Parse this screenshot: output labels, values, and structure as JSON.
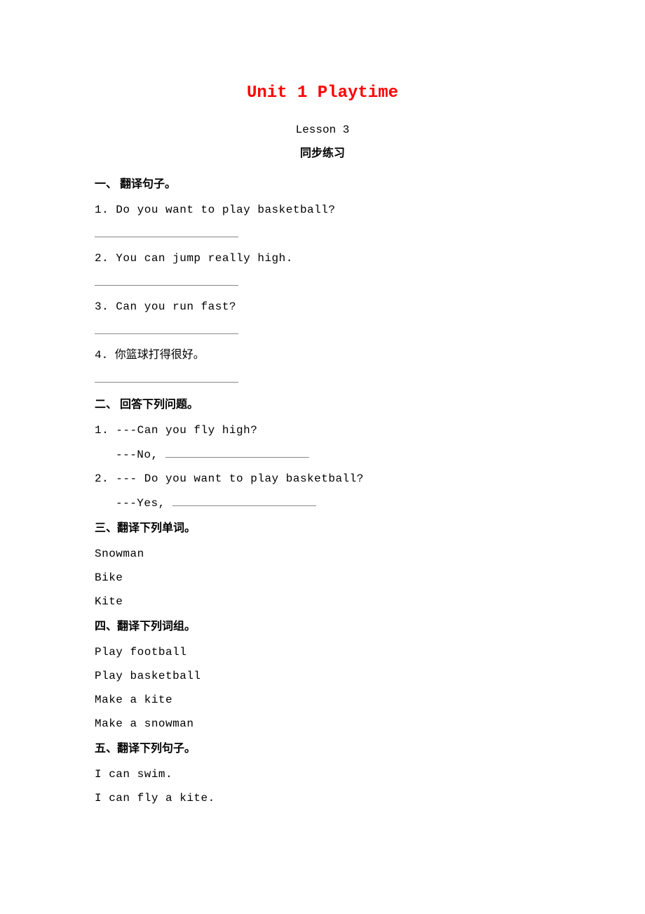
{
  "title": "Unit 1 Playtime",
  "lesson": "Lesson 3",
  "practice_label": "同步练习",
  "section1": {
    "header": "一、  翻译句子。",
    "items": [
      "1.  Do you want to play basketball?",
      "2.  You can jump really high.",
      "3.  Can you run fast?",
      "4.  你篮球打得很好。"
    ]
  },
  "section2": {
    "header": "二、  回答下列问题。",
    "q1_line1": "1.  ---Can you fly high?",
    "q1_line2_prefix": "---No, ",
    "q2_line1": "2.  --- Do you want to play basketball?",
    "q2_line2_prefix": "---Yes, "
  },
  "section3": {
    "header": "三、翻译下列单词。",
    "words": [
      "Snowman",
      "Bike",
      "Kite"
    ]
  },
  "section4": {
    "header": "四、翻译下列词组。",
    "phrases": [
      "Play football",
      "Play basketball",
      "Make a kite",
      "Make a snowman"
    ]
  },
  "section5": {
    "header": "五、翻译下列句子。",
    "sentences": [
      "I can swim.",
      "I can fly a kite."
    ]
  }
}
